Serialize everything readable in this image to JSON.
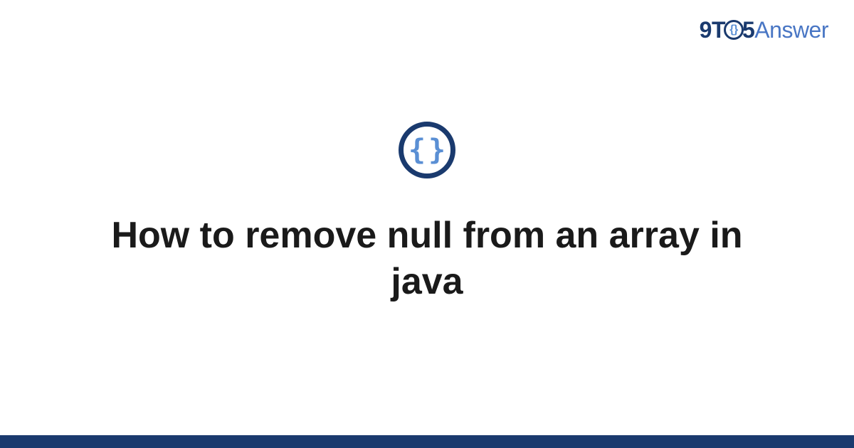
{
  "brand": {
    "part1": "9T",
    "circle_inner": "{}",
    "part2": "5",
    "part3": "Answer"
  },
  "icon": {
    "braces": "{}",
    "name": "code-braces-icon"
  },
  "title": "How to remove null from an array in java",
  "colors": {
    "dark_blue": "#1a3a6e",
    "light_blue": "#5a8fd4",
    "mid_blue": "#4976c4",
    "text": "#1a1a1a"
  }
}
